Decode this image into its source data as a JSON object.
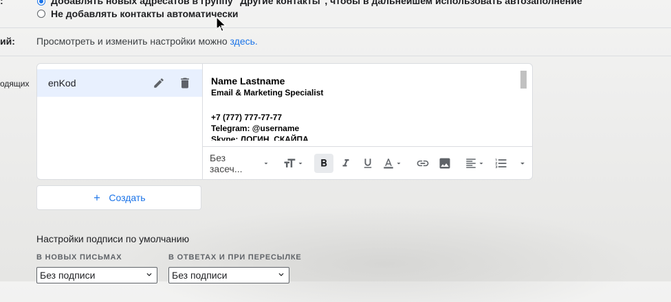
{
  "auto_contacts": {
    "option_add": "Добавлять новых адресатов в группу \"Другие контакты\", чтобы в дальнейшем использовать автозаполнение",
    "option_no_add": "Не добавлять контакты автоматически"
  },
  "settings_row": {
    "label": "ий:",
    "text": "Просмотреть и изменить настройки можно ",
    "link": "здесь",
    "suffix": "."
  },
  "signature_row": {
    "label": "одящих"
  },
  "signatures": {
    "items": [
      {
        "name": "enKod"
      }
    ],
    "content": {
      "name": "Name Lastname",
      "title": "Email & Marketing Specialist",
      "phone": "+7 (777) 777-77-77",
      "telegram": "Telegram: @username",
      "skype": "Skype: ЛОГИН_СКАЙПА"
    },
    "toolbar": {
      "font_label": "Без засеч...",
      "bold_active": true
    },
    "create_label": "Создать"
  },
  "defaults": {
    "title": "Настройки подписи по умолчанию",
    "new_label": "В НОВЫХ ПИСЬМАХ",
    "reply_label": "В ОТВЕТАХ И ПРИ ПЕРЕСЫЛКЕ",
    "new_value": "Без подписи",
    "reply_value": "Без подписи"
  },
  "colors": {
    "accent": "#1a73e8",
    "selected_item": "#e8f0fe"
  }
}
